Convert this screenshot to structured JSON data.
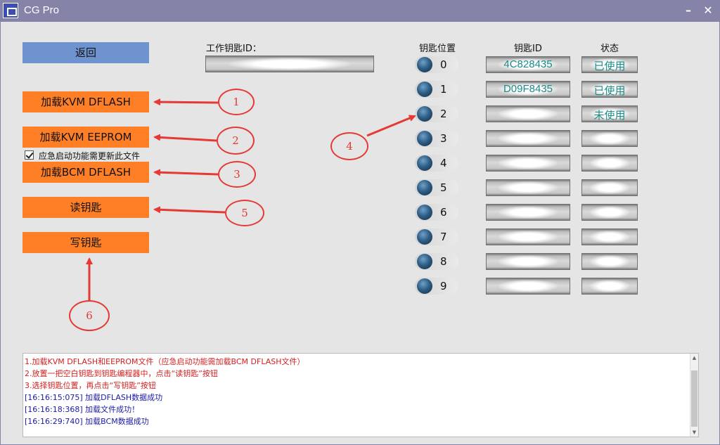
{
  "window": {
    "title": "CG Pro",
    "minimize": "–",
    "close": "✕"
  },
  "left": {
    "back": "返回",
    "load_kvm_dflash": "加载KVM  DFLASH",
    "load_kvm_eeprom": "加载KVM  EEPROM",
    "emergency_checkbox": "应急启动功能需更新此文件",
    "load_bcm_dflash": "加载BCM  DFLASH",
    "read_key": "读钥匙",
    "write_key": "写钥匙"
  },
  "work_key": {
    "label": "工作钥匙ID：",
    "value": ""
  },
  "table": {
    "col_position": "钥匙位置",
    "col_key_id": "钥匙ID",
    "col_status": "状态",
    "rows": [
      {
        "pos": "0",
        "key_id": "4C828435",
        "status": "已使用"
      },
      {
        "pos": "1",
        "key_id": "D09F8435",
        "status": "已使用"
      },
      {
        "pos": "2",
        "key_id": "",
        "status": "未使用"
      },
      {
        "pos": "3",
        "key_id": "",
        "status": ""
      },
      {
        "pos": "4",
        "key_id": "",
        "status": ""
      },
      {
        "pos": "5",
        "key_id": "",
        "status": ""
      },
      {
        "pos": "6",
        "key_id": "",
        "status": ""
      },
      {
        "pos": "7",
        "key_id": "",
        "status": ""
      },
      {
        "pos": "8",
        "key_id": "",
        "status": ""
      },
      {
        "pos": "9",
        "key_id": "",
        "status": ""
      }
    ]
  },
  "annotations": [
    "1",
    "2",
    "3",
    "4",
    "5",
    "6"
  ],
  "log": [
    {
      "text": "1.加载KVM   DFLASH和EEPROM文件（应急启动功能需加载BCM   DFLASH文件）",
      "color": "red"
    },
    {
      "text": "2.放置一把空白钥匙到钥匙编程器中，点击“读钥匙”按钮",
      "color": "red"
    },
    {
      "text": "3.选择钥匙位置，再点击“写钥匙”按钮",
      "color": "red"
    },
    {
      "text": "[16:16:15:075]   加载DFLASH数据成功",
      "color": "blue"
    },
    {
      "text": "[16:16:18:368]   加载文件成功！",
      "color": "blue"
    },
    {
      "text": "[16:16:29:740]   加载BCM数据成功",
      "color": "blue"
    }
  ],
  "colors": {
    "accent_orange": "#ff7f27",
    "back_blue": "#6f93cf",
    "titlebar": "#8683a8",
    "annotation_red": "#e53935",
    "key_text": "#1a8a8a"
  }
}
